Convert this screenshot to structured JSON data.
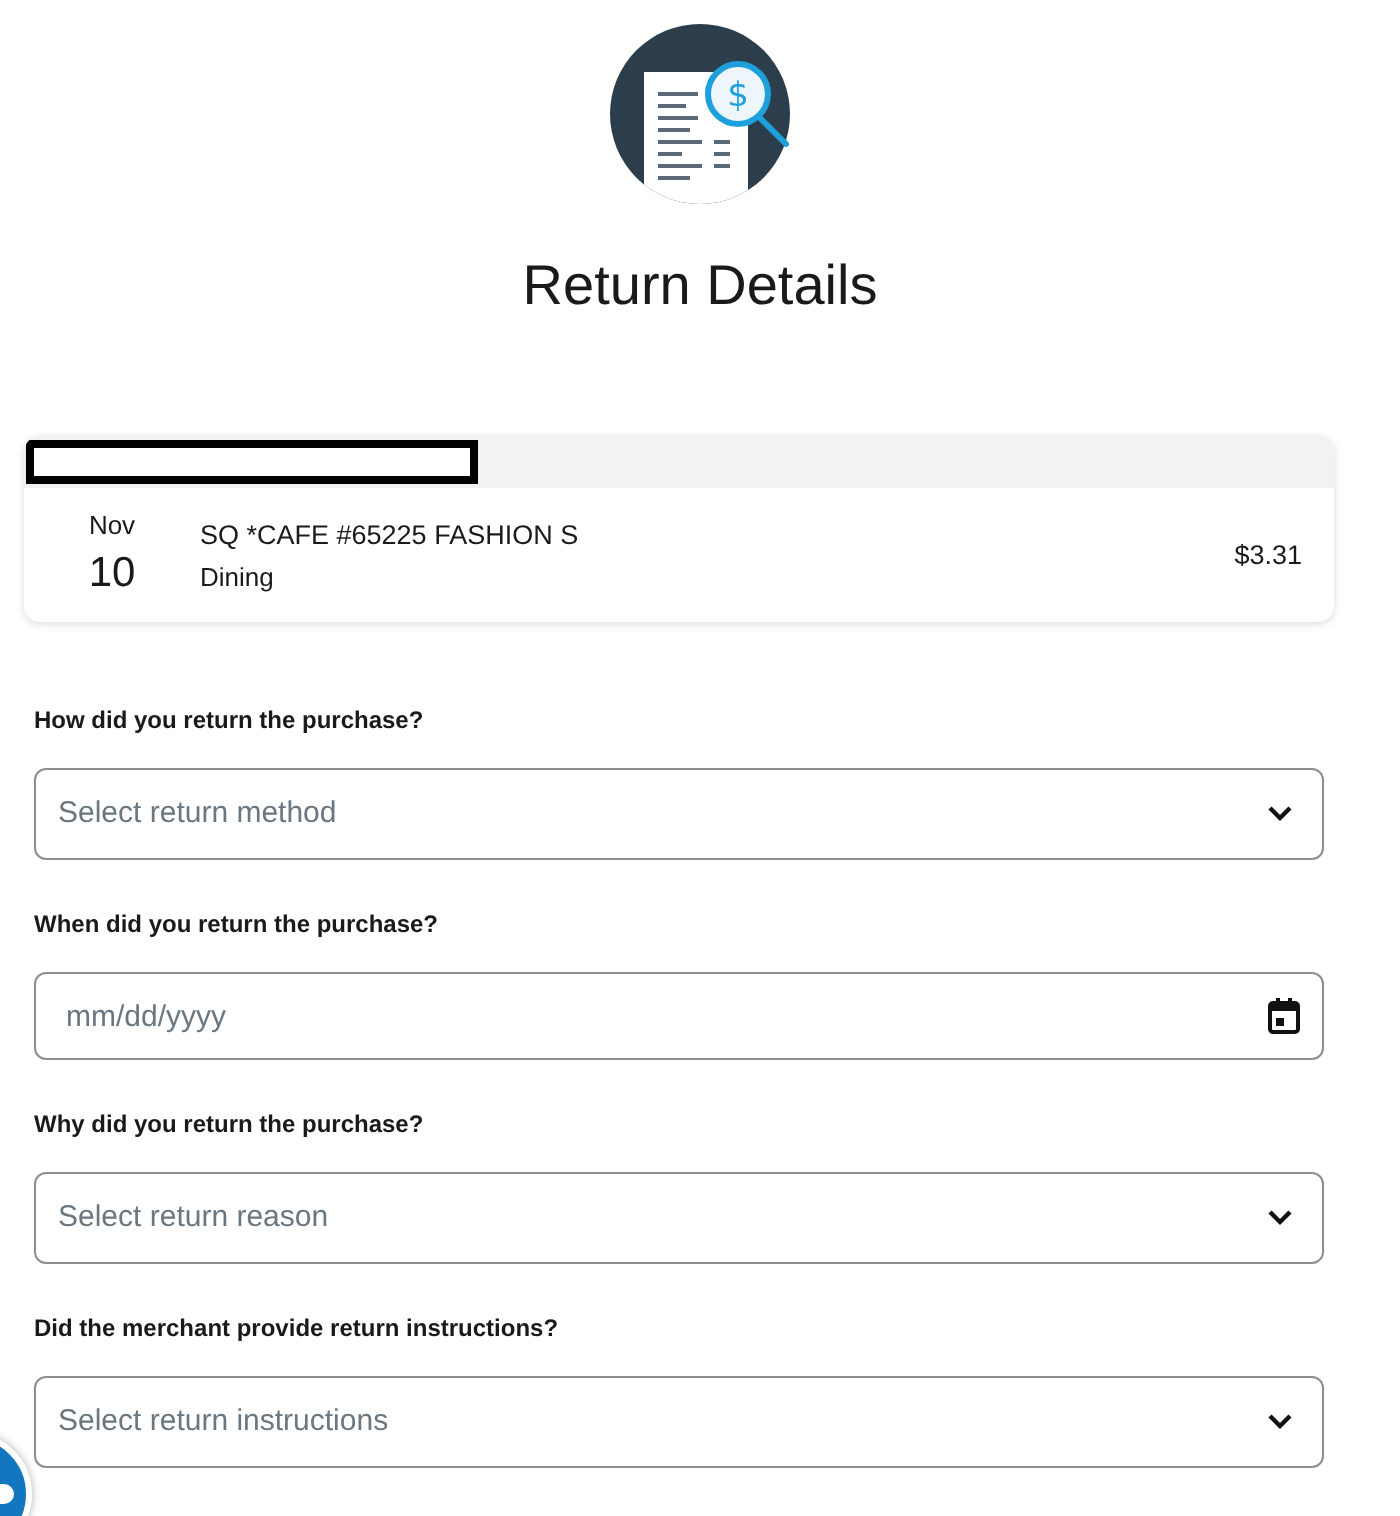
{
  "header": {
    "icon_symbol": "$",
    "title": "Return Details"
  },
  "transaction": {
    "month": "Nov",
    "day": "10",
    "merchant": "SQ *CAFE #65225 FASHION S",
    "category": "Dining",
    "amount": "$3.31"
  },
  "fields": [
    {
      "kind": "select",
      "label": "How did you return the purchase?",
      "placeholder": "Select return method"
    },
    {
      "kind": "date",
      "label": "When did you return the purchase?",
      "placeholder": "mm/dd/yyyy"
    },
    {
      "kind": "select",
      "label": "Why did you return the purchase?",
      "placeholder": "Select return reason"
    },
    {
      "kind": "select",
      "label": "Did the merchant provide return instructions?",
      "placeholder": "Select return instructions"
    }
  ]
}
